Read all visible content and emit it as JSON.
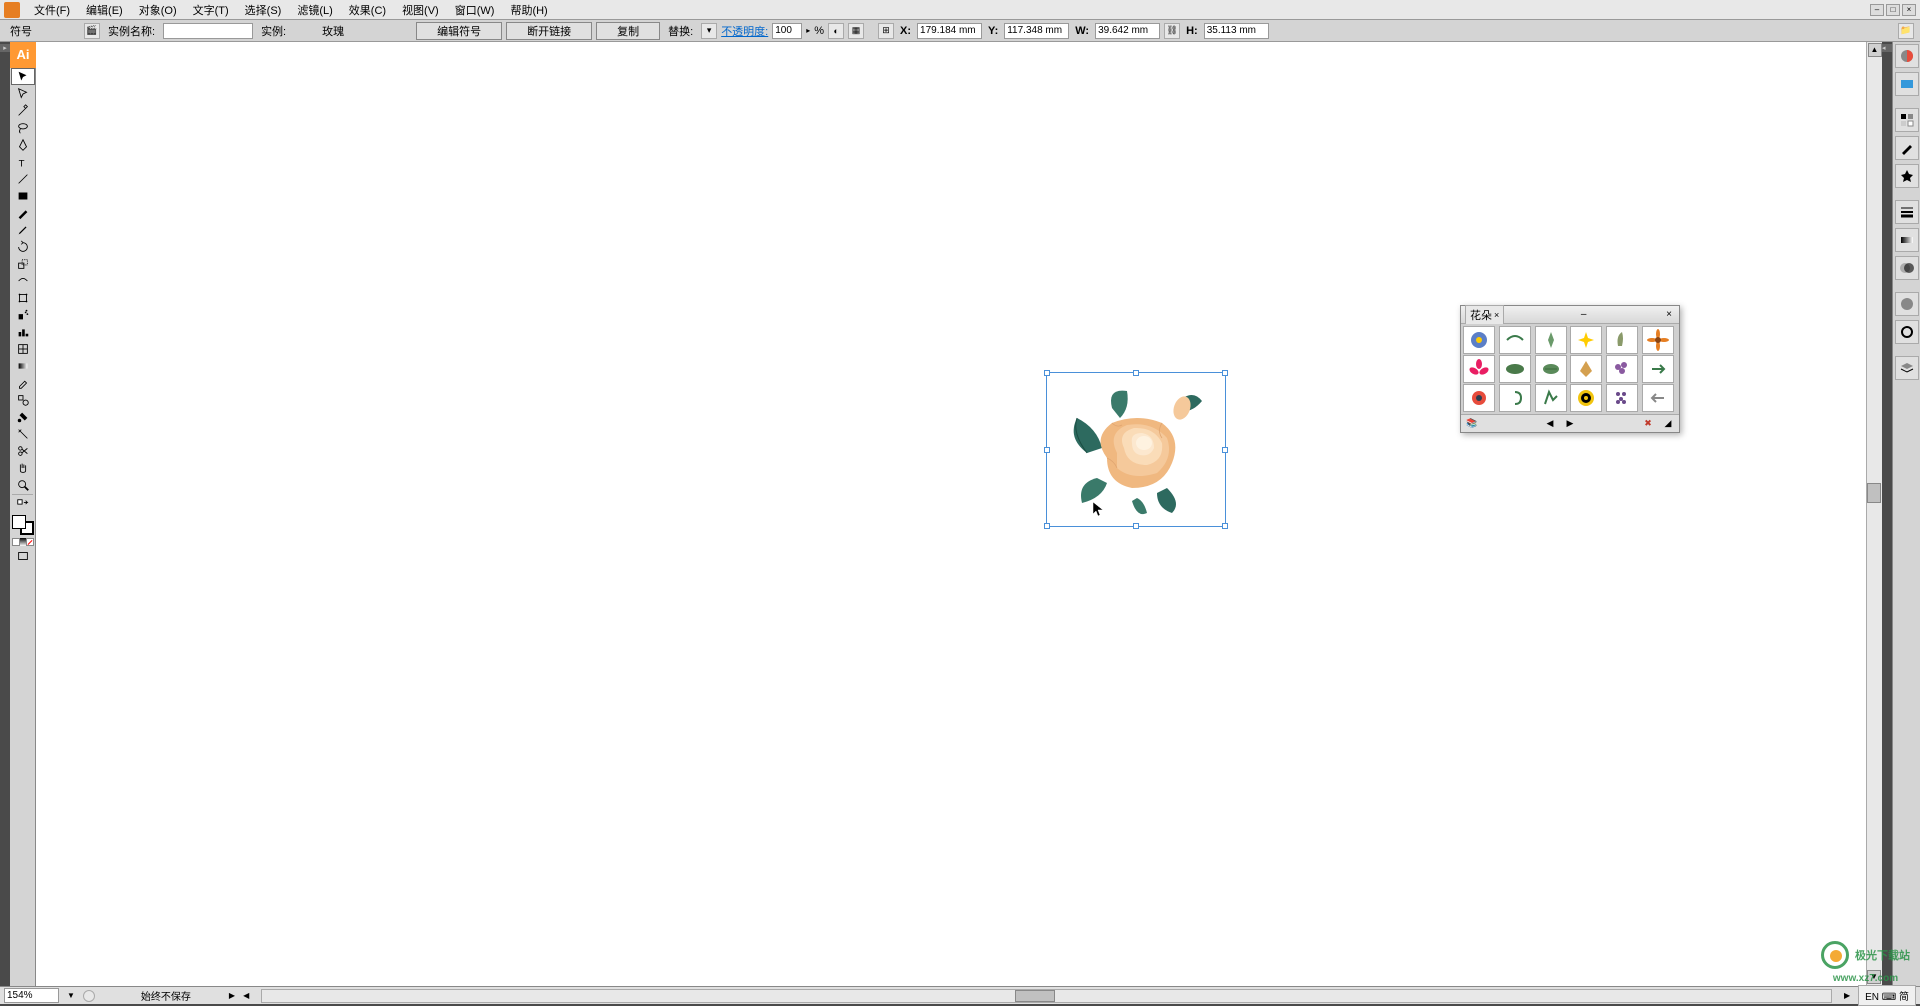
{
  "menu": {
    "items": [
      "文件(F)",
      "编辑(E)",
      "对象(O)",
      "文字(T)",
      "选择(S)",
      "滤镜(L)",
      "效果(C)",
      "视图(V)",
      "窗口(W)",
      "帮助(H)"
    ]
  },
  "control_bar": {
    "symbol_label": "符号",
    "instance_name_label": "实例名称:",
    "instance_name_value": "",
    "instance_label": "实例:",
    "instance_value": "玫瑰",
    "edit_symbol_btn": "编辑符号",
    "break_link_btn": "断开链接",
    "duplicate_btn": "复制",
    "replace_label": "替换:",
    "opacity_label": "不透明度:",
    "opacity_value": "100",
    "opacity_unit": "%",
    "x_label": "X:",
    "x_value": "179.184 mm",
    "y_label": "Y:",
    "y_value": "117.348 mm",
    "w_label": "W:",
    "w_value": "39.642 mm",
    "h_label": "H:",
    "h_value": "35.113 mm"
  },
  "float_panel": {
    "title": "花朵",
    "close": "×"
  },
  "status": {
    "zoom": "154%",
    "info": "始终不保存",
    "lang": "EN ⌨ 简"
  },
  "watermark": {
    "text": "极光下载站",
    "url": "www.xz7.com"
  },
  "tools": [
    "selection",
    "direct-selection",
    "magic-wand",
    "lasso",
    "pen",
    "type",
    "line",
    "rectangle",
    "paintbrush",
    "pencil",
    "rotate",
    "scale",
    "warp",
    "free-transform",
    "symbol-sprayer",
    "column-graph",
    "mesh",
    "gradient",
    "eyedropper",
    "blend",
    "live-paint",
    "slice",
    "scissors",
    "hand",
    "zoom"
  ],
  "right_panels": [
    "color",
    "swatches",
    "stroke",
    "gradient",
    "transparency",
    "appearance",
    "graphic-styles",
    "layers",
    "links",
    "actions",
    "brushes",
    "symbols",
    "align"
  ]
}
